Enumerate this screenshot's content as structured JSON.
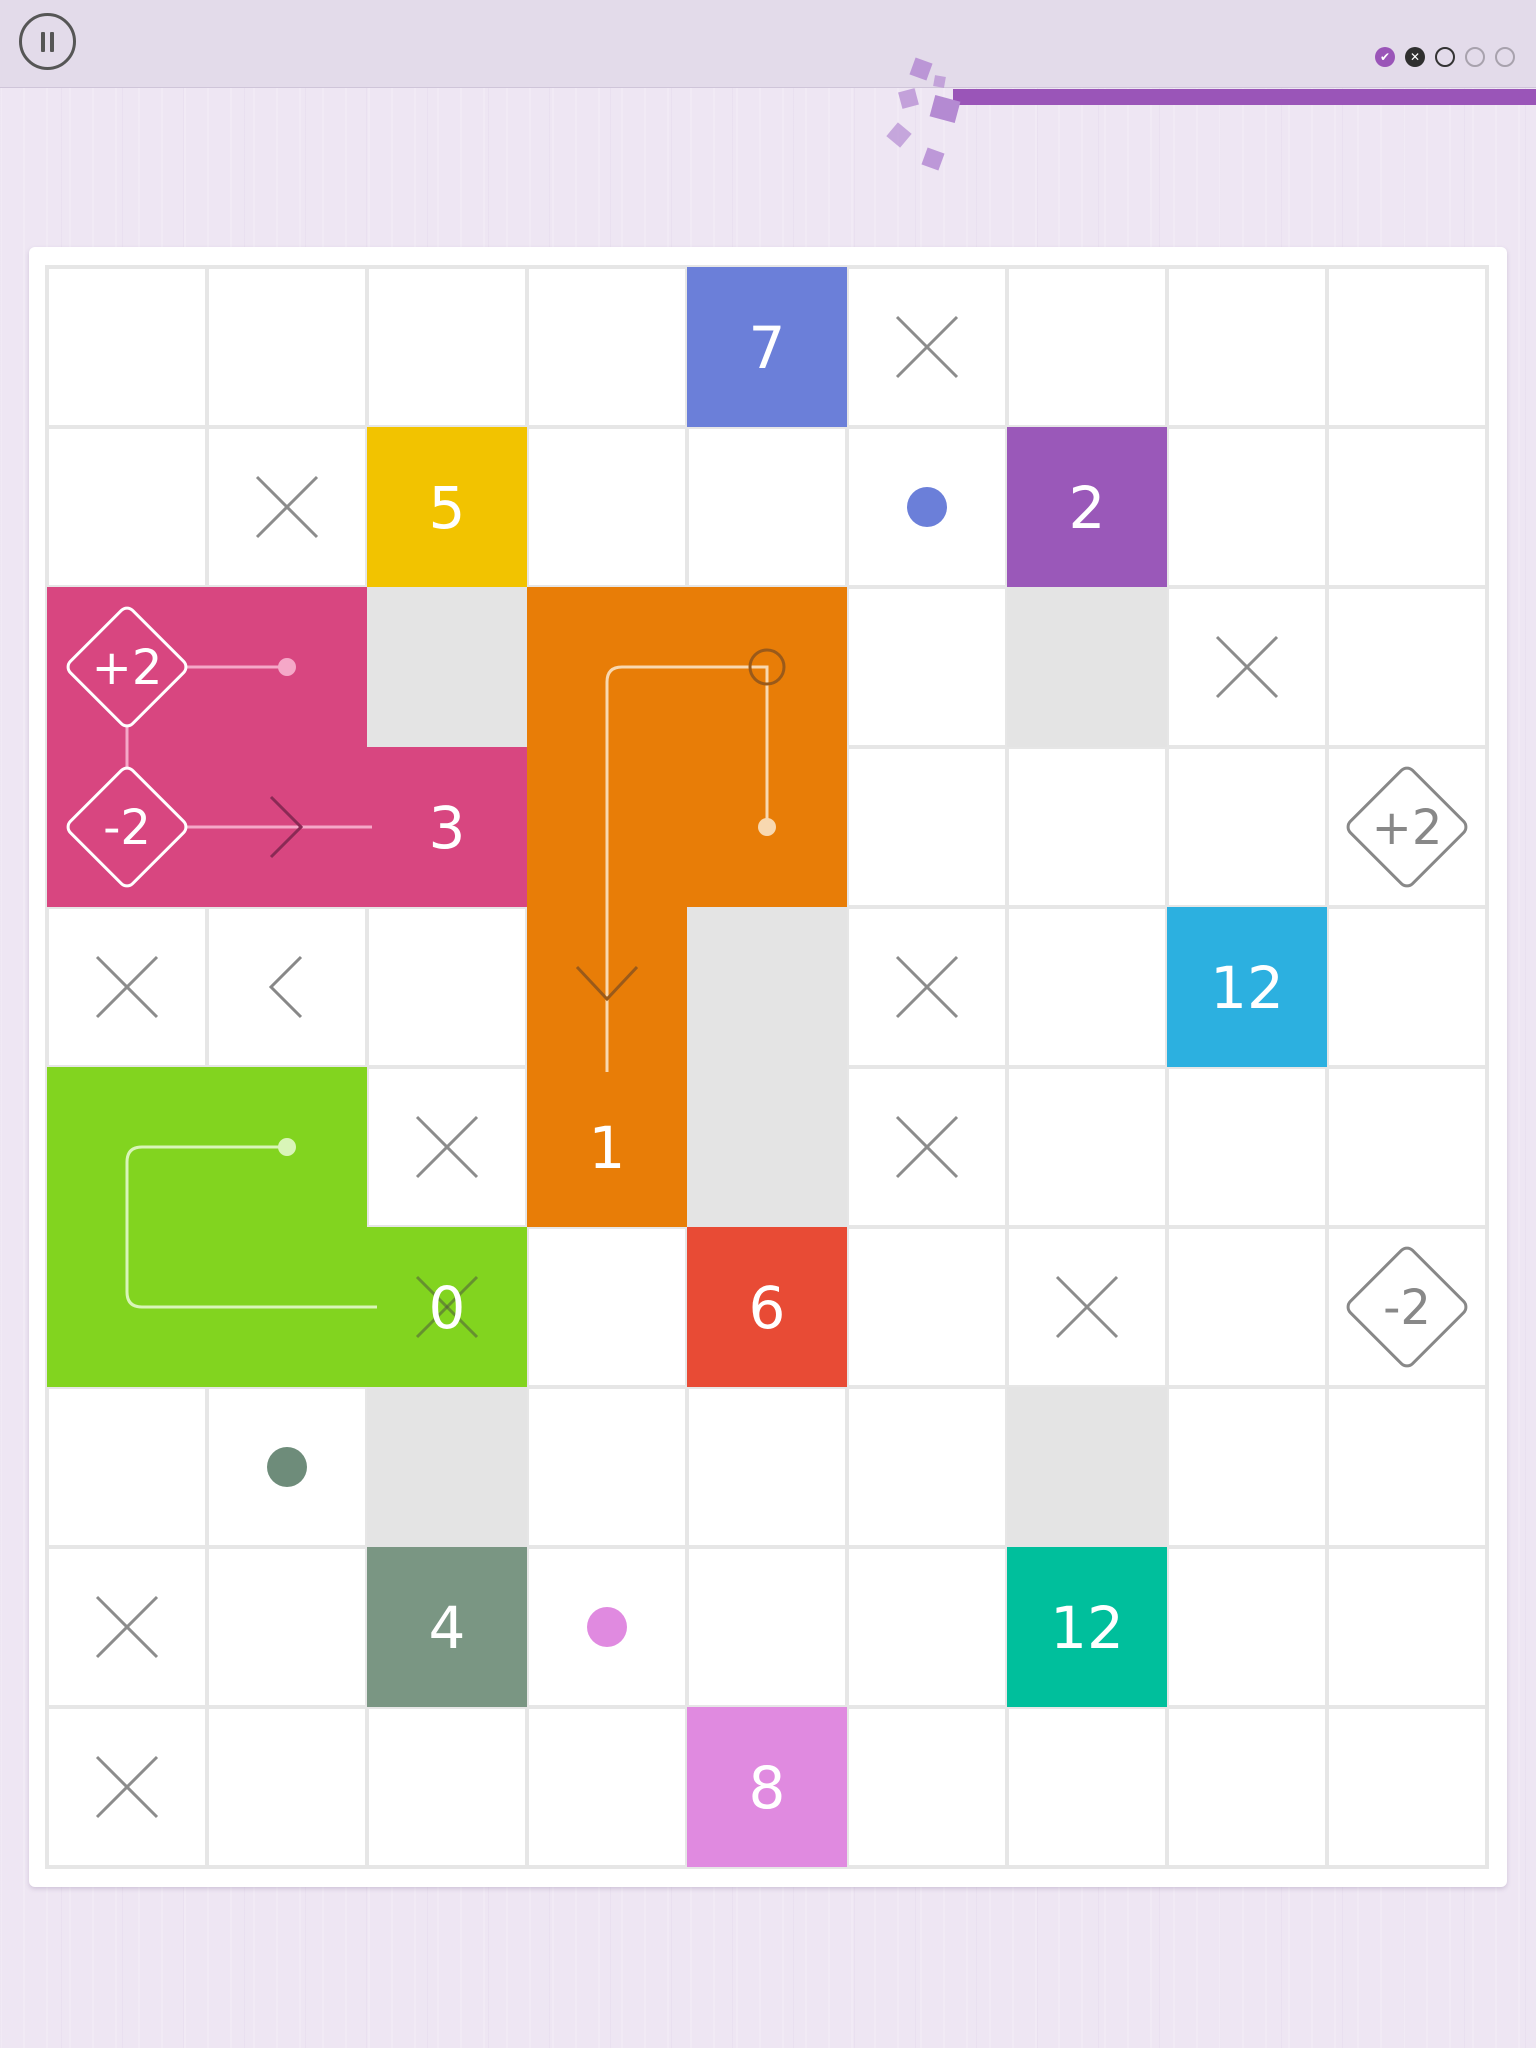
{
  "toolbar": {
    "pause_icon": "pause-icon",
    "level_dots": [
      {
        "state": "done",
        "glyph": "✔",
        "color": "#9a55b8"
      },
      {
        "state": "failed",
        "glyph": "✕",
        "color": "#2f2f2f"
      },
      {
        "state": "current",
        "glyph": "",
        "color": "#333333"
      },
      {
        "state": "pending",
        "glyph": "",
        "color": "#a8a2ad"
      },
      {
        "state": "pending",
        "glyph": "",
        "color": "#a8a2ad"
      }
    ],
    "progress_fraction": 0.38,
    "progress_color": "#9a55b8"
  },
  "board": {
    "rows": 10,
    "cols": 9,
    "tiles": [
      {
        "row": 0,
        "col": 4,
        "label": "7",
        "color": "#6b7fd9"
      },
      {
        "row": 1,
        "col": 2,
        "label": "5",
        "color": "#f2c300"
      },
      {
        "row": 1,
        "col": 6,
        "label": "2",
        "color": "#9a58b9"
      },
      {
        "row": 3,
        "col": 2,
        "label": "3",
        "color": "#d84680"
      },
      {
        "row": 4,
        "col": 7,
        "label": "12",
        "color": "#2cb0e0"
      },
      {
        "row": 5,
        "col": 3,
        "label": "1",
        "color": "#e87d07"
      },
      {
        "row": 6,
        "col": 2,
        "label": "0",
        "color": "#82d41f"
      },
      {
        "row": 6,
        "col": 4,
        "label": "6",
        "color": "#e84b35"
      },
      {
        "row": 8,
        "col": 2,
        "label": "4",
        "color": "#7a9683"
      },
      {
        "row": 8,
        "col": 6,
        "label": "12",
        "color": "#00bf9c"
      },
      {
        "row": 9,
        "col": 4,
        "label": "8",
        "color": "#e08ae0"
      }
    ],
    "painted_regions": [
      {
        "color": "#d84680",
        "cells": [
          [
            2,
            0
          ],
          [
            2,
            1
          ],
          [
            3,
            0
          ],
          [
            3,
            1
          ],
          [
            3,
            2
          ]
        ]
      },
      {
        "color": "#e87d07",
        "cells": [
          [
            2,
            3
          ],
          [
            2,
            4
          ],
          [
            3,
            3
          ],
          [
            3,
            4
          ],
          [
            4,
            3
          ],
          [
            5,
            3
          ]
        ]
      },
      {
        "color": "#82d41f",
        "cells": [
          [
            5,
            0
          ],
          [
            5,
            1
          ],
          [
            6,
            0
          ],
          [
            6,
            1
          ],
          [
            6,
            2
          ]
        ]
      }
    ],
    "gray_cells": [
      [
        2,
        2
      ],
      [
        2,
        6
      ],
      [
        4,
        4
      ],
      [
        5,
        4
      ],
      [
        7,
        2
      ],
      [
        7,
        6
      ]
    ],
    "x_marks": [
      [
        0,
        5
      ],
      [
        1,
        1
      ],
      [
        2,
        7
      ],
      [
        4,
        0
      ],
      [
        4,
        5
      ],
      [
        5,
        2
      ],
      [
        5,
        5
      ],
      [
        6,
        2
      ],
      [
        6,
        6
      ],
      [
        8,
        0
      ],
      [
        9,
        0
      ]
    ],
    "dots": [
      {
        "row": 1,
        "col": 5,
        "color": "#6b7fd9"
      },
      {
        "row": 7,
        "col": 1,
        "color": "#6e8c7a"
      },
      {
        "row": 8,
        "col": 3,
        "color": "#e08ae0"
      }
    ],
    "chevrons": [
      {
        "row": 4,
        "col": 1,
        "direction": "left",
        "color": "#888888"
      }
    ],
    "modifiers": [
      {
        "row": 2,
        "col": 0,
        "label": "+2",
        "color": "#ffffff"
      },
      {
        "row": 3,
        "col": 0,
        "label": "-2",
        "color": "#ffffff"
      },
      {
        "row": 3,
        "col": 8,
        "label": "+2",
        "color": "#888888"
      },
      {
        "row": 6,
        "col": 8,
        "label": "-2",
        "color": "#888888"
      }
    ]
  },
  "colors": {
    "grid_line": "#e6e6e6",
    "gray_cell": "#e4e4e4",
    "x_mark": "#8c8c8c",
    "pink_path": "#f5a8c8",
    "orange_path": "#f8d8b0",
    "orange_path_dark": "#9a5a1a",
    "green_path": "#d9f5b8"
  }
}
